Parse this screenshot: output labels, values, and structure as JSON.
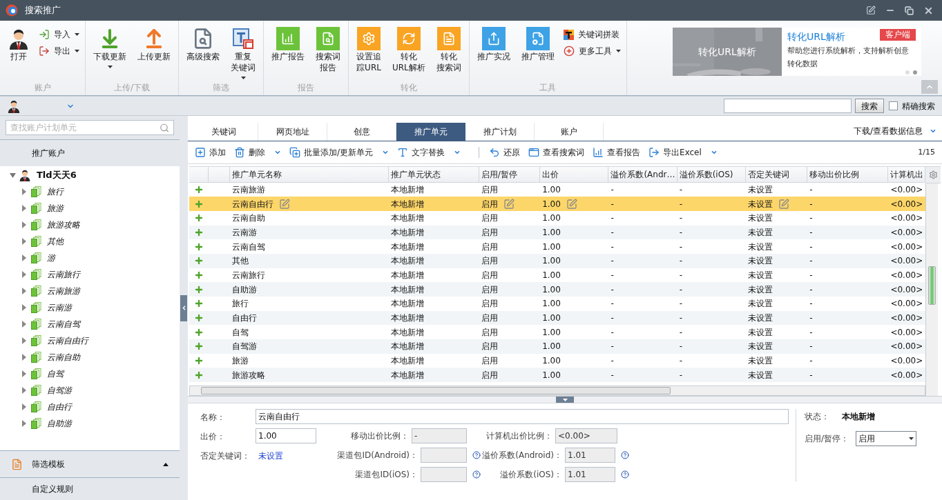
{
  "window": {
    "title": "搜索推广"
  },
  "ribbon": {
    "groups": [
      {
        "label": "账户",
        "items": [
          {
            "kind": "large",
            "lines": [
              "打开"
            ],
            "menu": false
          },
          {
            "kind": "small",
            "lines": [
              "导入"
            ],
            "menu": true
          },
          {
            "kind": "small",
            "lines": [
              "导出"
            ],
            "menu": true
          }
        ]
      },
      {
        "label": "上传/下载",
        "items": [
          {
            "kind": "large",
            "lines": [
              "下载更新"
            ],
            "menu": true
          },
          {
            "kind": "large",
            "lines": [
              "上传更新"
            ],
            "menu": false
          }
        ]
      },
      {
        "label": "筛选",
        "items": [
          {
            "kind": "large",
            "lines": [
              "高级搜索"
            ],
            "menu": false
          },
          {
            "kind": "large",
            "lines": [
              "重复",
              "关键词"
            ],
            "menu": true
          }
        ]
      },
      {
        "label": "报告",
        "items": [
          {
            "kind": "large",
            "lines": [
              "推广报告"
            ],
            "menu": false
          },
          {
            "kind": "large",
            "lines": [
              "搜索词",
              "报告"
            ],
            "menu": false
          }
        ]
      },
      {
        "label": "转化",
        "items": [
          {
            "kind": "large",
            "lines": [
              "设置追",
              "踪URL"
            ],
            "menu": false
          },
          {
            "kind": "large",
            "lines": [
              "转化",
              "URL解析"
            ],
            "menu": false
          },
          {
            "kind": "large",
            "lines": [
              "转化",
              "搜索词"
            ],
            "menu": false
          }
        ]
      },
      {
        "label": "工具",
        "items": [
          {
            "kind": "large",
            "lines": [
              "推广实况"
            ],
            "menu": false
          },
          {
            "kind": "large",
            "lines": [
              "推广管理"
            ],
            "menu": false
          },
          {
            "kind": "small",
            "lines": [
              "关键词拼装"
            ],
            "menu": false
          },
          {
            "kind": "small",
            "lines": [
              "更多工具"
            ],
            "menu": true
          }
        ]
      }
    ]
  },
  "banner": {
    "caption": "转化URL解析",
    "title": "转化URL解析",
    "badge": "客户端",
    "description": "帮助您进行系统解析，支持解析创意转化数据",
    "dots": [
      {
        "selected": false
      },
      {
        "selected": true
      }
    ]
  },
  "account_bar": {
    "search_button": "搜索",
    "exact_search": {
      "label": "精确搜索",
      "checked": false
    }
  },
  "sidebar": {
    "search_placeholder": "查找账户计划单元",
    "header": "推广账户",
    "tree": [
      {
        "label": "Tld天天6",
        "expanded": true,
        "children": [
          {
            "label": "旅行",
            "expanded": false
          },
          {
            "label": "旅游",
            "expanded": false
          },
          {
            "label": "旅游攻略",
            "expanded": false
          },
          {
            "label": "其他",
            "expanded": false
          },
          {
            "label": "游",
            "expanded": false
          },
          {
            "label": "云南旅行",
            "expanded": false
          },
          {
            "label": "云南旅游",
            "expanded": false
          },
          {
            "label": "云南游",
            "expanded": false
          },
          {
            "label": "云南自驾",
            "expanded": false
          },
          {
            "label": "云南自由行",
            "expanded": false
          },
          {
            "label": "云南自助",
            "expanded": false
          },
          {
            "label": "自驾",
            "expanded": false
          },
          {
            "label": "自驾游",
            "expanded": false
          },
          {
            "label": "自由行",
            "expanded": false
          },
          {
            "label": "自助游",
            "expanded": false
          }
        ]
      }
    ],
    "filter_section": {
      "label": "筛选模板",
      "expanded": true
    },
    "custom_rules": "自定义规则"
  },
  "tabs": [
    {
      "label": "关键词",
      "selected": false
    },
    {
      "label": "网页地址",
      "selected": false
    },
    {
      "label": "创意",
      "selected": false
    },
    {
      "label": "推广单元",
      "selected": true
    },
    {
      "label": "推广计划",
      "selected": false
    },
    {
      "label": "账户",
      "selected": false
    }
  ],
  "data_menu": "下载/查看数据信息",
  "toolbar": {
    "items": [
      {
        "kind": "button",
        "label": "添加",
        "menu": false
      },
      {
        "kind": "button",
        "label": "删除",
        "menu": true
      },
      {
        "kind": "button",
        "label": "批量添加/更新单元",
        "menu": true
      },
      {
        "kind": "button",
        "label": "文字替换",
        "menu": true
      },
      {
        "kind": "separator"
      },
      {
        "kind": "button",
        "label": "还原",
        "menu": false
      },
      {
        "kind": "button",
        "label": "查看搜索词",
        "menu": false
      },
      {
        "kind": "button",
        "label": "查看报告",
        "menu": false
      },
      {
        "kind": "button",
        "label": "导出Excel",
        "menu": true
      }
    ],
    "page": "1/15"
  },
  "table": {
    "columns": [
      "推广单元名称",
      "推广单元状态",
      "启用/暂停",
      "出价",
      "溢价系数(Andr…",
      "溢价系数(iOS)",
      "否定关键词",
      "移动出价比例",
      "计算机出"
    ],
    "rows": [
      {
        "cells": [
          "云南旅游",
          "本地新增",
          "启用",
          "1.00",
          "-",
          "-",
          "未设置",
          "-",
          "<0.00>"
        ],
        "selected": false
      },
      {
        "cells": [
          "云南自由行",
          "本地新增",
          "启用",
          "1.00",
          "-",
          "-",
          "未设置",
          "-",
          "<0.00>"
        ],
        "selected": true
      },
      {
        "cells": [
          "云南自助",
          "本地新增",
          "启用",
          "1.00",
          "-",
          "-",
          "未设置",
          "-",
          "<0.00>"
        ],
        "selected": false
      },
      {
        "cells": [
          "云南游",
          "本地新增",
          "启用",
          "1.00",
          "-",
          "-",
          "未设置",
          "-",
          "<0.00>"
        ],
        "selected": false
      },
      {
        "cells": [
          "云南自驾",
          "本地新增",
          "启用",
          "1.00",
          "-",
          "-",
          "未设置",
          "-",
          "<0.00>"
        ],
        "selected": false
      },
      {
        "cells": [
          "其他",
          "本地新增",
          "启用",
          "1.00",
          "-",
          "-",
          "未设置",
          "-",
          "<0.00>"
        ],
        "selected": false
      },
      {
        "cells": [
          "云南旅行",
          "本地新增",
          "启用",
          "1.00",
          "-",
          "-",
          "未设置",
          "-",
          "<0.00>"
        ],
        "selected": false
      },
      {
        "cells": [
          "自助游",
          "本地新增",
          "启用",
          "1.00",
          "-",
          "-",
          "未设置",
          "-",
          "<0.00>"
        ],
        "selected": false
      },
      {
        "cells": [
          "旅行",
          "本地新增",
          "启用",
          "1.00",
          "-",
          "-",
          "未设置",
          "-",
          "<0.00>"
        ],
        "selected": false
      },
      {
        "cells": [
          "自由行",
          "本地新增",
          "启用",
          "1.00",
          "-",
          "-",
          "未设置",
          "-",
          "<0.00>"
        ],
        "selected": false
      },
      {
        "cells": [
          "自驾",
          "本地新增",
          "启用",
          "1.00",
          "-",
          "-",
          "未设置",
          "-",
          "<0.00>"
        ],
        "selected": false
      },
      {
        "cells": [
          "自驾游",
          "本地新增",
          "启用",
          "1.00",
          "-",
          "-",
          "未设置",
          "-",
          "<0.00>"
        ],
        "selected": false
      },
      {
        "cells": [
          "旅游",
          "本地新增",
          "启用",
          "1.00",
          "-",
          "-",
          "未设置",
          "-",
          "<0.00>"
        ],
        "selected": false
      },
      {
        "cells": [
          "旅游攻略",
          "本地新增",
          "启用",
          "1.00",
          "-",
          "-",
          "未设置",
          "-",
          "<0.00>"
        ],
        "selected": false
      }
    ]
  },
  "form": {
    "name": {
      "label": "名称：",
      "value": "云南自由行"
    },
    "bid": {
      "label": "出价：",
      "value": "1.00"
    },
    "mobile_ratio": {
      "label": "移动出价比例：",
      "value": "-",
      "disabled": true
    },
    "computer_ratio": {
      "label": "计算机出价比例：",
      "value": "<0.00>",
      "disabled": true
    },
    "negative": {
      "label": "否定关键词：",
      "value": "未设置"
    },
    "android_id": {
      "label": "渠道包ID(Android)：",
      "disabled": true
    },
    "android_coef": {
      "label": "溢价系数(Android)：",
      "value": "1.01",
      "disabled": true
    },
    "ios_id": {
      "label": "渠道包ID(iOS)：",
      "disabled": true
    },
    "ios_coef": {
      "label": "溢价系数(iOS)：",
      "value": "1.01",
      "disabled": true
    },
    "status": {
      "label": "状态：",
      "value": "本地新增"
    },
    "enable": {
      "label": "启用/暂停：",
      "value": "启用"
    }
  }
}
